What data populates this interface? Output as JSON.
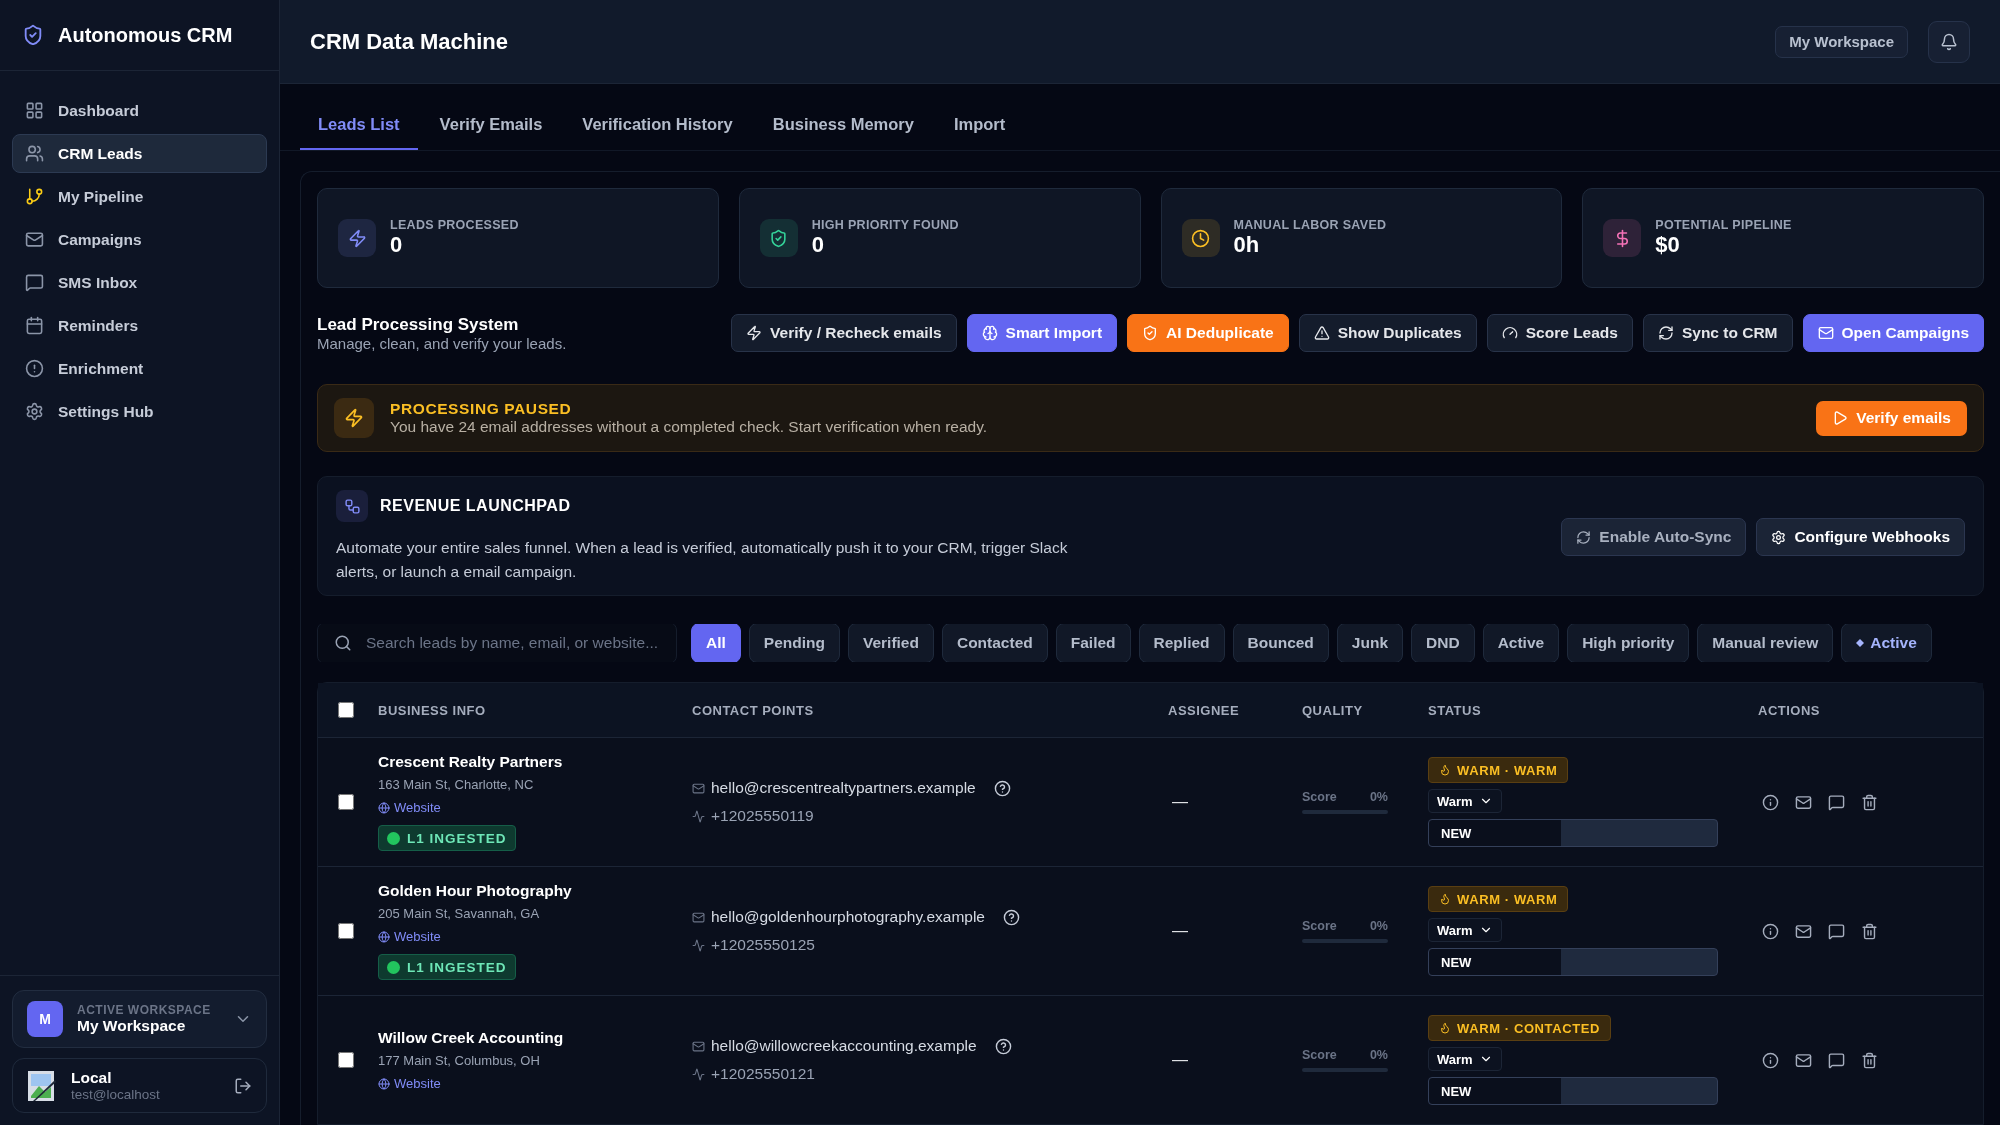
{
  "brand": {
    "name": "Autonomous CRM"
  },
  "sidebar": {
    "items": [
      {
        "label": "Dashboard",
        "selected": false
      },
      {
        "label": "CRM Leads",
        "selected": true
      },
      {
        "label": "My Pipeline",
        "selected": false
      },
      {
        "label": "Campaigns",
        "selected": false
      },
      {
        "label": "SMS Inbox",
        "selected": false
      },
      {
        "label": "Reminders",
        "selected": false
      },
      {
        "label": "Enrichment",
        "selected": false
      },
      {
        "label": "Settings Hub",
        "selected": false
      }
    ],
    "workspace": {
      "initial": "M",
      "caption": "ACTIVE WORKSPACE",
      "name": "My Workspace"
    },
    "user": {
      "name": "Local",
      "email": "test@localhost"
    }
  },
  "header": {
    "title": "CRM Data Machine",
    "workspace_button": "My Workspace"
  },
  "tabs": [
    {
      "label": "Leads List",
      "selected": true
    },
    {
      "label": "Verify Emails",
      "selected": false
    },
    {
      "label": "Verification History",
      "selected": false
    },
    {
      "label": "Business Memory",
      "selected": false
    },
    {
      "label": "Import",
      "selected": false
    }
  ],
  "stats": [
    {
      "label": "LEADS PROCESSED",
      "value": "0",
      "color": "#818cf8"
    },
    {
      "label": "HIGH PRIORITY FOUND",
      "value": "0",
      "color": "#34d399"
    },
    {
      "label": "MANUAL LABOR SAVED",
      "value": "0h",
      "color": "#fbbf24"
    },
    {
      "label": "POTENTIAL PIPELINE",
      "value": "$0",
      "color": "#f472b6"
    }
  ],
  "lead_system": {
    "title": "Lead Processing System",
    "subtitle": "Manage, clean, and verify your leads.",
    "actions": [
      {
        "label": "Verify / Recheck emails",
        "kind": "plain"
      },
      {
        "label": "Smart Import",
        "kind": "primary"
      },
      {
        "label": "AI Deduplicate",
        "kind": "warning"
      },
      {
        "label": "Show Duplicates",
        "kind": "plain"
      },
      {
        "label": "Score Leads",
        "kind": "plain"
      },
      {
        "label": "Sync to CRM",
        "kind": "plain"
      },
      {
        "label": "Open Campaigns",
        "kind": "primary"
      }
    ]
  },
  "banner": {
    "title": "PROCESSING PAUSED",
    "message": "You have 24 email addresses without a completed check. Start verification when ready.",
    "button": "Verify emails"
  },
  "launchpad": {
    "title": "REVENUE LAUNCHPAD",
    "description": "Automate your entire sales funnel. When a lead is verified, automatically push it to your CRM, trigger Slack alerts, or launch a email campaign.",
    "buttons": [
      {
        "label": "Enable Auto-Sync"
      },
      {
        "label": "Configure Webhooks"
      }
    ]
  },
  "search": {
    "placeholder": "Search leads by name, email, or website..."
  },
  "filters": [
    {
      "label": "All",
      "selected": true,
      "kind": "plain"
    },
    {
      "label": "Pending",
      "selected": false,
      "kind": "plain"
    },
    {
      "label": "Verified",
      "selected": false,
      "kind": "plain"
    },
    {
      "label": "Contacted",
      "selected": false,
      "kind": "plain"
    },
    {
      "label": "Failed",
      "selected": false,
      "kind": "plain"
    },
    {
      "label": "Replied",
      "selected": false,
      "kind": "plain"
    },
    {
      "label": "Bounced",
      "selected": false,
      "kind": "plain"
    },
    {
      "label": "Junk",
      "selected": false,
      "kind": "plain"
    },
    {
      "label": "DND",
      "selected": false,
      "kind": "plain"
    },
    {
      "label": "Active",
      "selected": false,
      "kind": "plain"
    },
    {
      "label": "High priority",
      "selected": false,
      "kind": "plain"
    },
    {
      "label": "Manual review",
      "selected": false,
      "kind": "plain"
    },
    {
      "label": "Active",
      "selected": false,
      "kind": "diamond"
    }
  ],
  "table": {
    "select_all_checked": false,
    "columns": [
      "BUSINESS INFO",
      "CONTACT POINTS",
      "ASSIGNEE",
      "QUALITY",
      "STATUS",
      "ACTIONS"
    ],
    "rows": [
      {
        "checked": false,
        "name": "Crescent Realty Partners",
        "address": "163 Main St, Charlotte, NC",
        "website": "Website",
        "badge": "L1 INGESTED",
        "email": "hello@crescentrealtypartners.example",
        "phone": "+12025550119",
        "assignee": "—",
        "score_label": "Score",
        "score": "0%",
        "level": 0,
        "status_tag": "WARM · WARM",
        "temperature": "Warm",
        "stage": "NEW"
      },
      {
        "checked": false,
        "name": "Golden Hour Photography",
        "address": "205 Main St, Savannah, GA",
        "website": "Website",
        "badge": "L1 INGESTED",
        "email": "hello@goldenhourphotography.example",
        "phone": "+12025550125",
        "assignee": "—",
        "score_label": "Score",
        "score": "0%",
        "level": 0,
        "status_tag": "WARM · WARM",
        "temperature": "Warm",
        "stage": "NEW"
      },
      {
        "checked": false,
        "name": "Willow Creek Accounting",
        "address": "177 Main St, Columbus, OH",
        "website": "Website",
        "email": "hello@willowcreekaccounting.example",
        "phone": "+12025550121",
        "assignee": "—",
        "score_label": "Score",
        "score": "0%",
        "level": 0,
        "status_tag": "WARM · CONTACTED",
        "temperature": "Warm",
        "stage": "NEW"
      }
    ]
  }
}
